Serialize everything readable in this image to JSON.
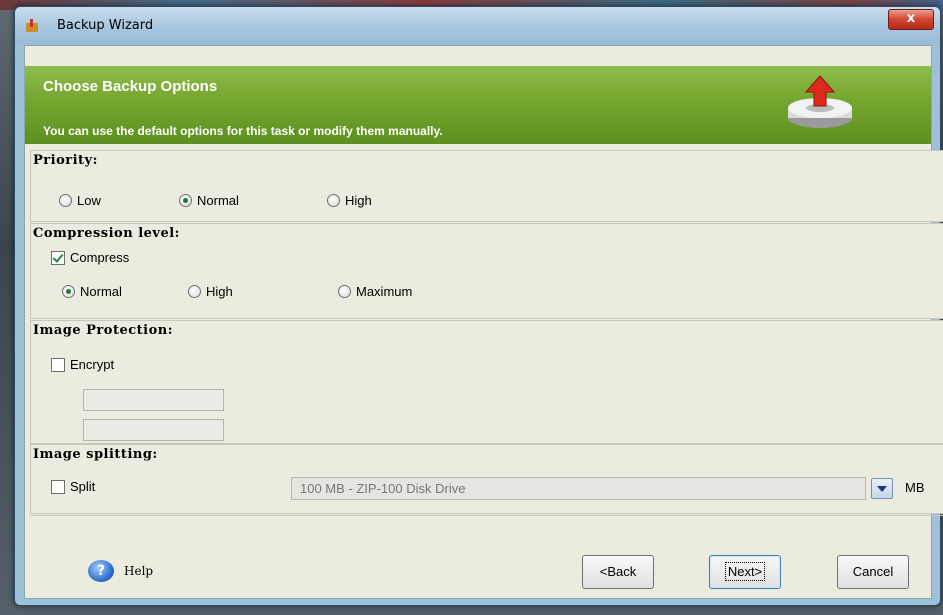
{
  "window": {
    "title": "Backup Wizard",
    "close_glyph": "x"
  },
  "header": {
    "title": "Choose Backup Options",
    "subtitle": "You can use the default options for this task or modify them manually.",
    "icon": "backup-disk-icon"
  },
  "priority": {
    "label": "Priority:",
    "options": [
      "Low",
      "Normal",
      "High"
    ],
    "selected": "Normal"
  },
  "compression": {
    "label": "Compression level:",
    "compress_label": "Compress",
    "compress_checked": true,
    "options": [
      "Normal",
      "High",
      "Maximum"
    ],
    "selected": "Normal"
  },
  "protection": {
    "label": "Image Protection:",
    "encrypt_label": "Encrypt",
    "encrypt_checked": false,
    "password_value": "",
    "confirm_value": ""
  },
  "splitting": {
    "label": "Image splitting:",
    "split_label": "Split",
    "split_checked": false,
    "size_value": "100 MB - ZIP-100 Disk Drive",
    "unit": "MB"
  },
  "footer": {
    "help_label": "Help",
    "help_glyph": "?",
    "back_label": "<Back",
    "next_label": "Next>",
    "cancel_label": "Cancel"
  },
  "colors": {
    "header_green": "#74a52e",
    "panel_bg": "#ebebe0",
    "radio_dot": "#1a7d2e"
  }
}
